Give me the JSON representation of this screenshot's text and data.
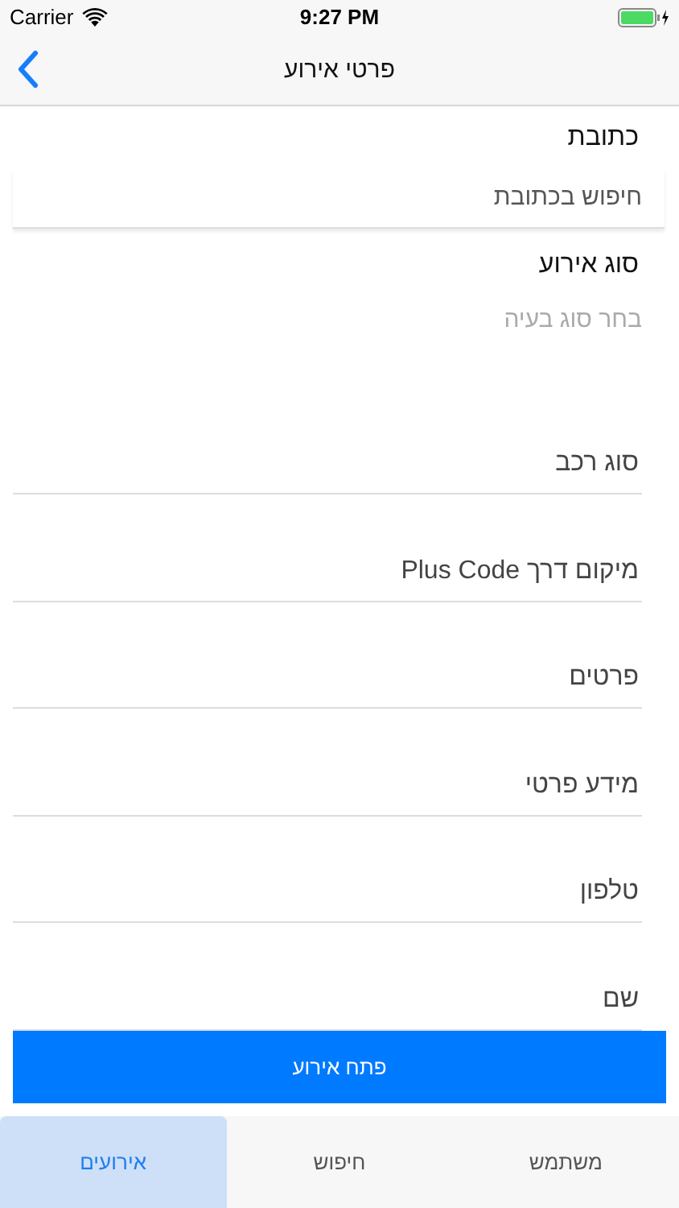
{
  "status_bar": {
    "carrier": "Carrier",
    "time": "9:27 PM"
  },
  "nav": {
    "title": "פרטי אירוע"
  },
  "address": {
    "label": "כתובת",
    "placeholder": "חיפוש בכתובת"
  },
  "event_type": {
    "label": "סוג אירוע",
    "placeholder": "בחר סוג בעיה"
  },
  "fields": [
    {
      "placeholder": "סוג רכב"
    },
    {
      "placeholder": "מיקום דרך Plus Code"
    },
    {
      "placeholder": "פרטים"
    },
    {
      "placeholder": "מידע פרטי"
    },
    {
      "placeholder": "טלפון"
    },
    {
      "placeholder": "שם"
    }
  ],
  "submit_button": "פתח אירוע",
  "tabs": [
    {
      "label": "משתמש",
      "selected": false
    },
    {
      "label": "חיפוש",
      "selected": false
    },
    {
      "label": "אירועים",
      "selected": true
    }
  ]
}
